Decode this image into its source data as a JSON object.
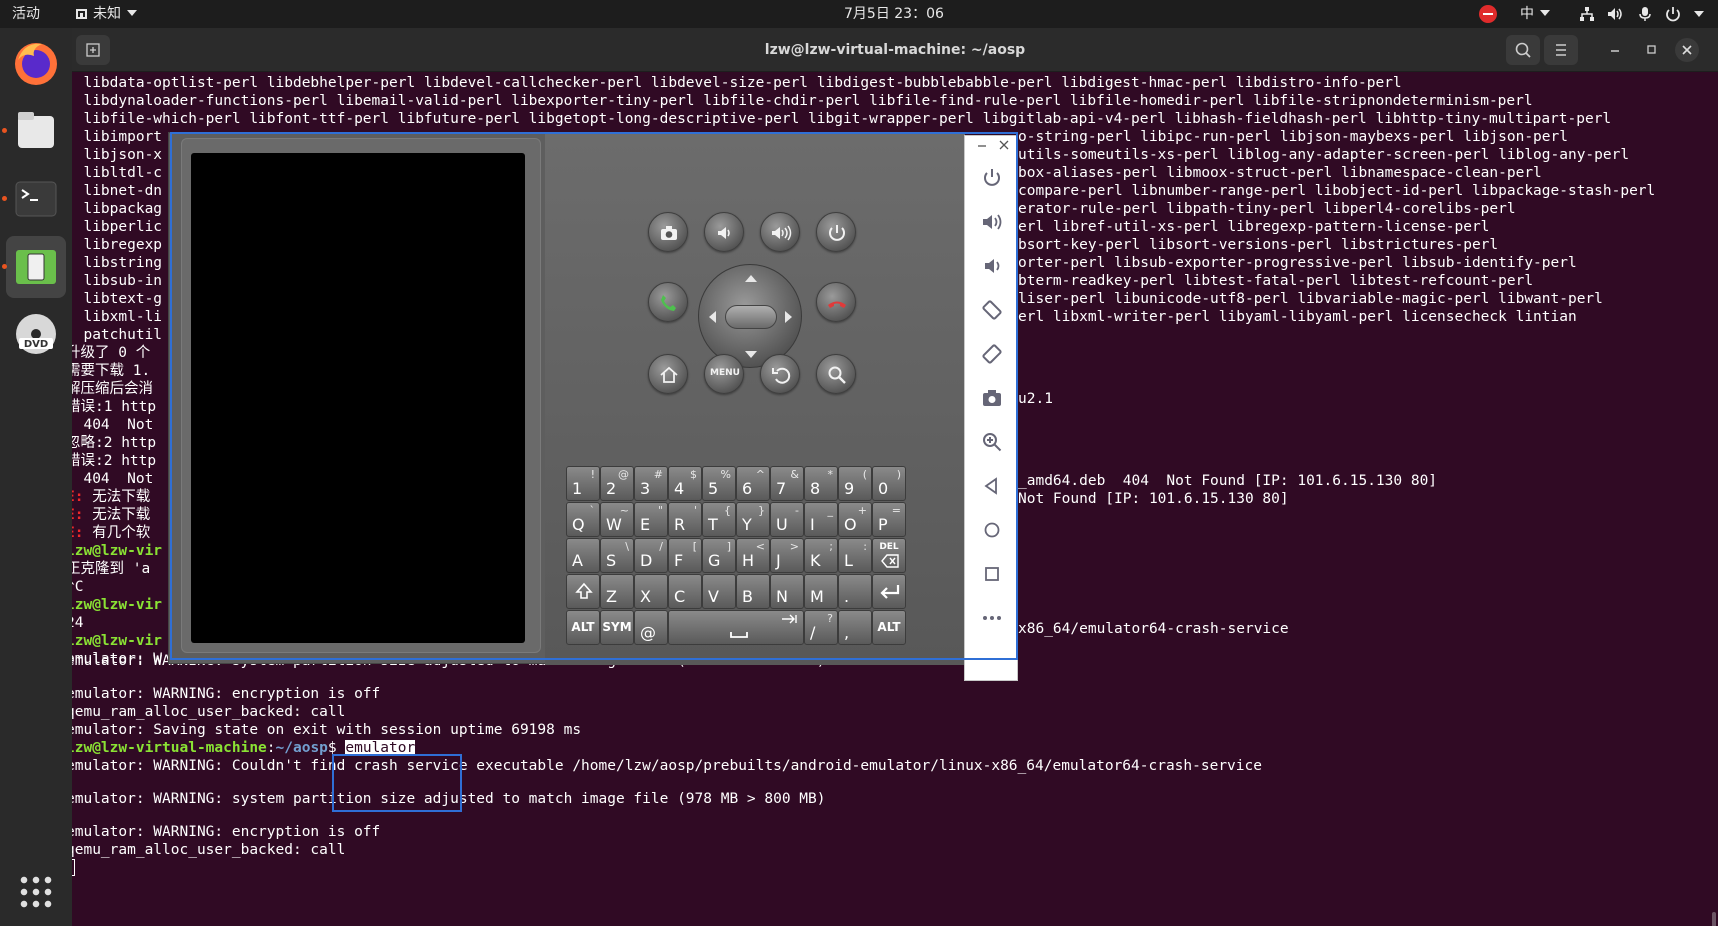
{
  "topbar": {
    "activities": "活动",
    "app_menu": "未知",
    "clock": "7月5日  23：06",
    "input_method": "中"
  },
  "colors": {
    "terminal_bg": "#300a24",
    "prompt_user": "#8ae234",
    "prompt_path": "#729fcf",
    "error": "#ef2929",
    "selection": "#2f6fd6"
  },
  "window": {
    "title": "lzw@lzw-virtual-machine: ~/aosp"
  },
  "terminal": {
    "lines": [
      "  libdata-optlist-perl libdebhelper-perl libdevel-callchecker-perl libdevel-size-perl libdigest-bubblebabble-perl libdigest-hmac-perl libdistro-info-perl",
      "  libdynaloader-functions-perl libemail-valid-perl libexporter-tiny-perl libfile-chdir-perl libfile-find-rule-perl libfile-homedir-perl libfile-stripnondeterminism-perl",
      "  libfile-which-perl libfont-ttf-perl libfuture-perl libgetopt-long-descriptive-perl libgit-wrapper-perl libgitlab-api-v4-perl libhash-fieldhash-perl libhttp-tiny-multipart-perl",
      "  libimport",
      "  libjson-x",
      "  libltdl-c",
      "  libnet-dn",
      "  libpackag",
      "  libperlic",
      "  libregexp",
      "  libstring",
      "  libsub-in",
      "  libtext-g",
      "  libxml-li",
      "  patchutil",
      "升级了 0 个",
      "需要下载 1.",
      "解压缩后会消",
      "错误:1 http",
      "  404  Not",
      "忽略:2 http",
      "错误:2 http",
      "  404  Not"
    ],
    "right_fragments": [
      "o-string-perl libipc-run-perl libjson-maybexs-perl libjson-perl",
      "utils-someutils-xs-perl liblog-any-adapter-screen-perl liblog-any-perl",
      "box-aliases-perl libmoox-struct-perl libnamespace-clean-perl",
      "compare-perl libnumber-range-perl libobject-id-perl libpackage-stash-perl",
      "erator-rule-perl libpath-tiny-perl libperl4-corelibs-perl",
      "erl libref-util-xs-perl libregexp-pattern-license-perl",
      "bsort-key-perl libsort-versions-perl libstrictures-perl",
      "orter-perl libsub-exporter-progressive-perl libsub-identify-perl",
      "bterm-readkey-perl libtest-fatal-perl libtest-refcount-perl",
      "liser-perl libunicode-utf8-perl libvariable-magic-perl libwant-perl",
      "erl libxml-writer-perl libyaml-libyaml-perl licensecheck lintian",
      "u2.1",
      "_amd64.deb  404  Not Found [IP: 101.6.15.130 80]",
      "Not Found [IP: 101.6.15.130 80]",
      "x86_64/emulator64-crash-service"
    ],
    "errors": [
      {
        "prefix": "E:",
        "text": " 无法下载"
      },
      {
        "prefix": "E:",
        "text": " 无法下载"
      },
      {
        "prefix": "E:",
        "text": " 有几个软"
      }
    ],
    "prompt_user": "lzw@lzw-vir",
    "clone_line": "正克隆到 'a",
    "ctrl_c": "^C",
    "num_line": "24",
    "emu_warn_prefix": "emulator: W",
    "warn_partition": "emulator: WARNING: system partition size adjusted to match image file (978 MB > 800 MB)",
    "warn_encryption": "emulator: WARNING: encryption is off",
    "qemu_line": "qemu_ram_alloc_user_backed: call",
    "saving_line": "emulator: Saving state on exit with session uptime 69198 ms",
    "prompt_full": "lzw@lzw-virtual-machine",
    "prompt_colon": ":",
    "prompt_path": "~/aosp",
    "prompt_dollar": "$ ",
    "command": "emulator",
    "warn_crash": "emulator: WARNING: Couldn't find crash service executable /home/lzw/aosp/prebuilts/android-emulator/linux-x86_64/emulator64-crash-service"
  },
  "emulator": {
    "menu_label": "MENU",
    "keyboard": {
      "row1": [
        [
          "1",
          "!"
        ],
        [
          "2",
          "@"
        ],
        [
          "3",
          "#"
        ],
        [
          "4",
          "$"
        ],
        [
          "5",
          "%"
        ],
        [
          "6",
          "^"
        ],
        [
          "7",
          "&"
        ],
        [
          "8",
          "*"
        ],
        [
          "9",
          "("
        ],
        [
          "0",
          ")"
        ]
      ],
      "row2": [
        [
          "Q",
          "`"
        ],
        [
          "W",
          "~"
        ],
        [
          "E",
          "\""
        ],
        [
          "R",
          "'"
        ],
        [
          "T",
          "{"
        ],
        [
          "Y",
          "}"
        ],
        [
          "U",
          "-"
        ],
        [
          "I",
          "_"
        ],
        [
          "O",
          "+"
        ],
        [
          "P",
          "="
        ]
      ],
      "row3": [
        [
          "A",
          ""
        ],
        [
          "S",
          "\\"
        ],
        [
          "D",
          "/"
        ],
        [
          "F",
          "["
        ],
        [
          "G",
          "]"
        ],
        [
          "H",
          "<"
        ],
        [
          "J",
          ">"
        ],
        [
          "K",
          ";"
        ],
        [
          "L",
          ":"
        ]
      ],
      "del": "DEL",
      "row4": [
        "Z",
        "X",
        "C",
        "V",
        "B",
        "N",
        "M",
        "."
      ],
      "alt": "ALT",
      "sym": "SYM",
      "at": "@",
      "slash": "/",
      "question": "?",
      "comma": ","
    }
  }
}
